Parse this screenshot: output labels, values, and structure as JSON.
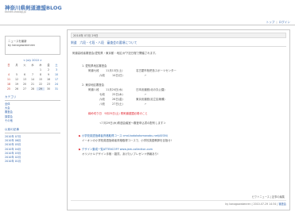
{
  "site": {
    "title": "神奈川県剣道連盟BLOG",
    "subtitle": "kanren.exblog.jp"
  },
  "top_nav": {
    "top": "トップ",
    "login": "ログイン"
  },
  "sidebar": {
    "profile_line1": "ニュースを最新",
    "profile_line2": "by kanagawakenren",
    "calendar": {
      "title": "< July 2010 >",
      "weekdays": [
        "日",
        "月",
        "火",
        "水",
        "木",
        "金",
        "土"
      ],
      "days": [
        "",
        "",
        "",
        "",
        "1",
        "2",
        "3",
        "4",
        "5",
        "6",
        "7",
        "8",
        "9",
        "10",
        "11",
        "12",
        "13",
        "14",
        "15",
        "16",
        "17",
        "18",
        "19",
        "20",
        "21",
        "22",
        "23",
        "24",
        "25",
        "26",
        "27",
        "28",
        "29",
        "30",
        "31"
      ]
    },
    "category_title": "カテゴリ",
    "categories": [
      "全体",
      "大会",
      "審査会",
      "講習会",
      "その他"
    ],
    "archive_title": "以前の記事",
    "archives": [
      "2010年 07月",
      "2010年 06月",
      "2010年 05月",
      "2010年 04月",
      "2010年 03月",
      "2010年 02月",
      "2010年 01月"
    ]
  },
  "post": {
    "date": "2010年 07月 29日",
    "title": "剣道　六段・七段・八段　審査会の要項について",
    "intro": "剣道高段者審査会(愛知県・東京都・地区)が下記日程で開催されます。",
    "section1_title": "1. 愛知県地区審査会",
    "section1_rows": [
      {
        "label": "剣道七段",
        "date": "11月13日(土)",
        "place": "名古屋市枇杷島スポーツセンター"
      },
      {
        "label": "六段",
        "date": "14日(日)",
        "place": "〃"
      }
    ],
    "section2_title": "2. 東京地区審査会",
    "section2_rows": [
      {
        "label": "剣道八段",
        "date": "11月24日(水)",
        "place": "日本武道館(北の丸公園)"
      },
      {
        "label": "七段",
        "date": "25日(木)",
        "place": "〃"
      },
      {
        "label": "六段",
        "date": "26日(金)",
        "place": "東京武道館(足立区綾瀬)"
      },
      {
        "label": "八段",
        "date": "27日(土)",
        "place": "〃"
      }
    ],
    "deadline_red": "締め切り日　9月25日(土) 県剣道連盟必着のこと",
    "note": "＜7月29日(木)県連会議室～審査申込書の配布します＞",
    "link1_label": "小学校英語指導者資格取得コース",
    "link1_url": "cmd-kodokotomanabu.net/AEON/",
    "link1_desc": "イーオンの小学校英語指導者資格取得コースで、小学校英語教師を目指せ!",
    "link2_label": "デザイン集成一覧ATTENCOFF",
    "link2_url": "www.jam-collection.com",
    "link2_desc": "オリジナルデザイン手帳・雑貨。あげたいプレゼント情報あり!",
    "toolbar": "ピクトニュース | 記事の編集",
    "footer_prefix": "by kanagawakenren | 2010-07-29 14:34 |",
    "footer_link": "審査会"
  }
}
